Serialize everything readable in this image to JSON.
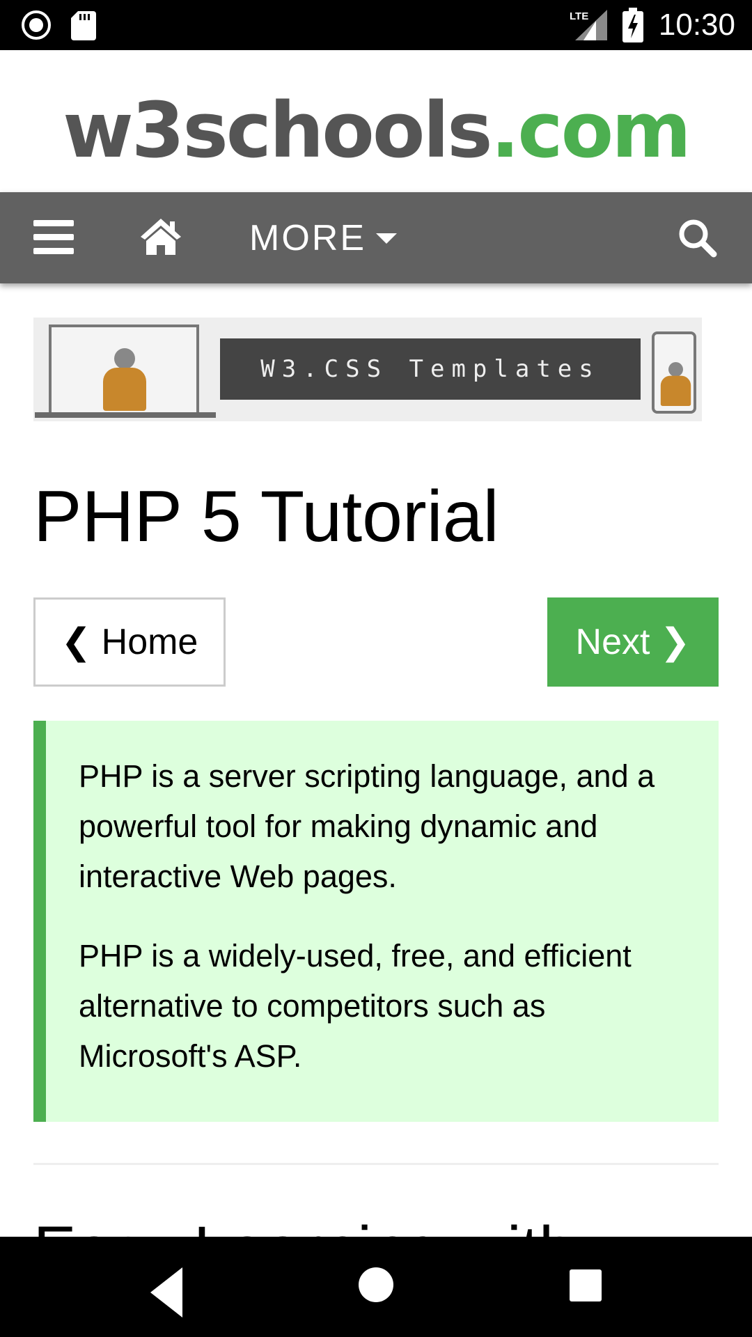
{
  "status_bar": {
    "time": "10:30",
    "network": "LTE",
    "left_icons": [
      "record-icon",
      "sd-card-icon"
    ],
    "right_icons": [
      "signal-icon",
      "battery-charging-icon"
    ]
  },
  "header": {
    "logo_main": "w3schools",
    "logo_tld": ".com"
  },
  "nav": {
    "more_label": "MORE",
    "icons": [
      "hamburger-menu-icon",
      "home-icon",
      "caret-down-icon",
      "search-icon"
    ]
  },
  "banner": {
    "label": "W3.CSS Templates"
  },
  "page": {
    "title": "PHP 5 Tutorial",
    "home_button": "❮ Home",
    "next_button": "Next ❯",
    "intro": [
      "PHP is a server scripting language, and a powerful tool for making dynamic and interactive Web pages.",
      "PHP is a widely-used, free, and efficient alternative to competitors such as Microsoft's ASP."
    ],
    "next_heading": "Easy Learning with"
  },
  "colors": {
    "brand_green": "#4CAF50",
    "nav_gray": "#616161",
    "panel_green": "#ddffdd",
    "logo_gray": "#555555"
  },
  "android_nav": {
    "icons": [
      "back-icon",
      "home-circle-icon",
      "recents-icon"
    ]
  }
}
